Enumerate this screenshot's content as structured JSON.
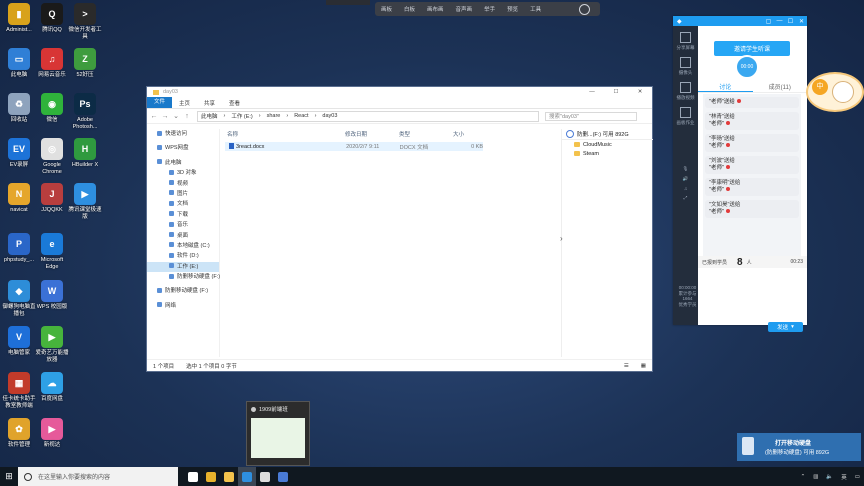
{
  "desktop": {
    "icons": [
      {
        "label": "Administ...",
        "color": "#d8a21b",
        "glyph": "▮"
      },
      {
        "label": "腾讯QQ",
        "color": "#1a1a1a",
        "glyph": "Q"
      },
      {
        "label": "微信开发者工具",
        "color": "#2a2a2a",
        "glyph": "&gt;"
      },
      {
        "label": "此电脑",
        "color": "#2f7fd6",
        "glyph": "▭"
      },
      {
        "label": "网易云音乐",
        "color": "#d83535",
        "glyph": "♫"
      },
      {
        "label": "52好压",
        "color": "#3e9c3e",
        "glyph": "Z"
      },
      {
        "label": "回收站",
        "color": "#8ea3bd",
        "glyph": "♻"
      },
      {
        "label": "微信",
        "color": "#2fb33b",
        "glyph": "◉"
      },
      {
        "label": "Adobe Photosh...",
        "color": "#0c2b46",
        "glyph": "Ps"
      },
      {
        "label": "EV录屏",
        "color": "#1d73d8",
        "glyph": "EV"
      },
      {
        "label": "Google Chrome",
        "color": "#e0e0e0",
        "glyph": "◎"
      },
      {
        "label": "HBuilder X",
        "color": "#2f9a3f",
        "glyph": "H"
      },
      {
        "label": "navicat",
        "color": "#e5a62b",
        "glyph": "N"
      },
      {
        "label": "JJQQKK",
        "color": "#b83e3e",
        "glyph": "J"
      },
      {
        "label": "腾讯课堂极速版",
        "color": "#2e8fe0",
        "glyph": "▶"
      },
      {
        "label": "phpstudy_...",
        "color": "#2a66c8",
        "glyph": "P"
      },
      {
        "label": "Microsoft Edge",
        "color": "#1a7ad8",
        "glyph": "e"
      },
      {
        "label": "御螺狗电脑直播包",
        "color": "#2d8dd8",
        "glyph": "◆"
      },
      {
        "label": "WPS 校园版",
        "color": "#3b71d6",
        "glyph": "W"
      },
      {
        "label": "电脑管家",
        "color": "#1e6fd8",
        "glyph": "V"
      },
      {
        "label": "爱奇艺万能播放器",
        "color": "#47b43c",
        "glyph": "▶"
      },
      {
        "label": "佳卡统卡助手教室教师端",
        "color": "#c23b2a",
        "glyph": "▦"
      },
      {
        "label": "百度网盘",
        "color": "#2ea0e6",
        "glyph": "☁"
      },
      {
        "label": "软件管理",
        "color": "#e0a32b",
        "glyph": "✿"
      },
      {
        "label": "新视达",
        "color": "#e65a9a",
        "glyph": "▶"
      }
    ]
  },
  "topbar": {
    "items": [
      "画板",
      "白板",
      "画布画",
      "音声画",
      "举手",
      "预览",
      "工具"
    ]
  },
  "explorer": {
    "title": "day03",
    "ribbon_tabs": [
      "文件",
      "主页",
      "共享",
      "查看"
    ],
    "path": [
      "此电脑",
      "工作 (E:)",
      "share",
      "React",
      "day03"
    ],
    "search_placeholder": "搜索\"day03\"",
    "nav_items": [
      {
        "label": "快速访问",
        "level": 0
      },
      {
        "label": "WPS网盘",
        "level": 0
      },
      {
        "label": "此电脑",
        "level": 0
      },
      {
        "label": "3D 对象",
        "level": 1
      },
      {
        "label": "视频",
        "level": 1
      },
      {
        "label": "图片",
        "level": 1
      },
      {
        "label": "文档",
        "level": 1
      },
      {
        "label": "下载",
        "level": 1
      },
      {
        "label": "音乐",
        "level": 1
      },
      {
        "label": "桌面",
        "level": 1
      },
      {
        "label": "本地磁盘 (C:)",
        "level": 1
      },
      {
        "label": "软件 (D:)",
        "level": 1
      },
      {
        "label": "工作 (E:)",
        "level": 1,
        "selected": true
      },
      {
        "label": "防删移动硬盘 (F:)",
        "level": 1
      },
      {
        "label": "防删移动硬盘 (F:)",
        "level": 0
      },
      {
        "label": "网络",
        "level": 0
      }
    ],
    "columns": [
      "名称",
      "修改日期",
      "类型",
      "大小"
    ],
    "files": [
      {
        "name": "3react.docx",
        "date": "2020/2/7 9:11",
        "type": "DOCX 文档",
        "size": "0 KB"
      }
    ],
    "detail_header": "防删...(F:) 可用 892G",
    "detail_items": [
      "CloudMusic",
      "Steam"
    ],
    "status_items": "1 个项目",
    "status_selected": "选中 1 个项目 0 字节"
  },
  "panel": {
    "header_icon": "◆",
    "sidebar": [
      "分享屏幕",
      "摄像头",
      "播放视频",
      "画板作业"
    ],
    "main_button": "邀请学生听课",
    "timer": "00:00",
    "tabs": [
      "讨论",
      "成员(11)"
    ],
    "messages": [
      {
        "name": "",
        "text": "\"老师\"送给"
      },
      {
        "name": "\"林青\"送给",
        "text": "\"老师\""
      },
      {
        "name": "\"李旸\"送给",
        "text": "\"老师\""
      },
      {
        "name": "\"刘波\"送给",
        "text": "\"老师\""
      },
      {
        "name": "\"李康明\"送给",
        "text": "\"老师\""
      },
      {
        "name": "\"文如昊\"送给",
        "text": "\"老师\""
      }
    ],
    "online_label": "已报到学员",
    "online_count": "8",
    "online_unit": "人",
    "online_time": "00:23",
    "send_button": "发送",
    "net_stats": [
      "00:00:00",
      "累计参与",
      "1664",
      "优秀学员"
    ]
  },
  "bubble": {
    "text": "中"
  },
  "usb_toast": {
    "title": "打开移动硬盘",
    "subtitle": "(防删移动硬盘) 可用 892G"
  },
  "thumbnail": {
    "title": "1909前端班"
  },
  "taskbar": {
    "search_placeholder": "在这里输入你要搜索的内容",
    "time": "",
    "apps": [
      {
        "name": "task-view",
        "color": "#ffffff"
      },
      {
        "name": "chrome",
        "color": "#e8b22c"
      },
      {
        "name": "file-explorer",
        "color": "#f3c24c"
      },
      {
        "name": "tencent-class",
        "color": "#2e8fe0",
        "active": true
      },
      {
        "name": "screen-recorder",
        "color": "#dddddd"
      },
      {
        "name": "browser",
        "color": "#4a7bd6"
      }
    ],
    "tray_text": "英"
  }
}
